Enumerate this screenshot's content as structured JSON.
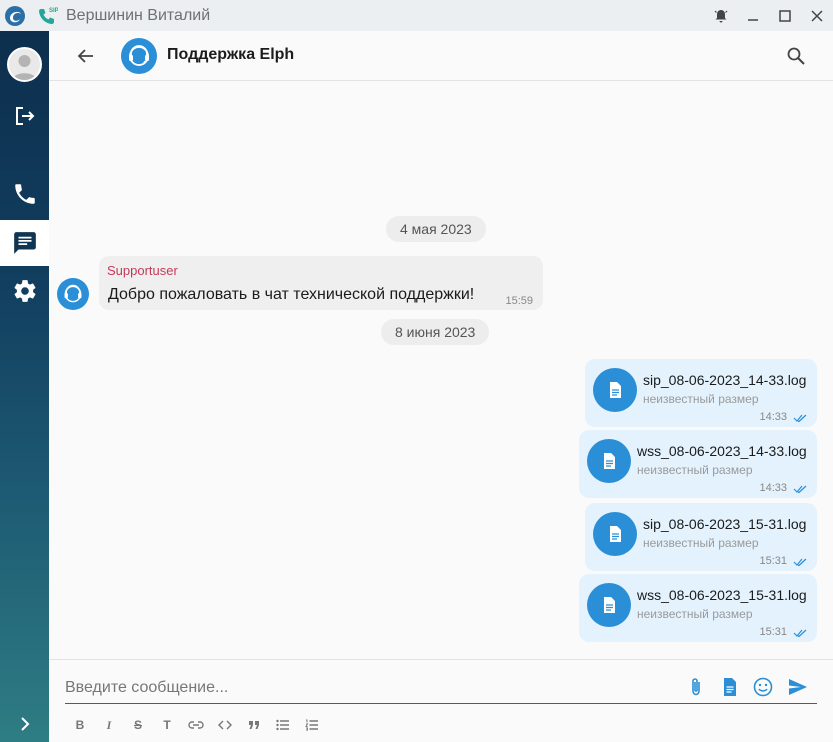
{
  "window": {
    "title": "Вершинин Виталий",
    "icons": [
      "app-logo-icon",
      "sip-phone-icon",
      "bell-icon",
      "minimize-icon",
      "maximize-icon",
      "close-icon"
    ]
  },
  "sidebar": {
    "items": [
      {
        "name": "avatar"
      },
      {
        "name": "logout-icon"
      },
      {
        "name": "phone-icon"
      },
      {
        "name": "chat-icon",
        "active": true
      },
      {
        "name": "gear-icon"
      },
      {
        "name": "chevron-right-icon"
      }
    ]
  },
  "header": {
    "title": "Поддержка Elph"
  },
  "messages": {
    "date1": "4 мая 2023",
    "incoming": {
      "sender": "Supportuser",
      "text": "Добро пожаловать в чат технической поддержки!",
      "time": "15:59"
    },
    "date2": "8 июня 2023",
    "files": [
      {
        "name": "sip_08-06-2023_14-33.log",
        "size": "неизвестный размер",
        "time": "14:33"
      },
      {
        "name": "wss_08-06-2023_14-33.log",
        "size": "неизвестный размер",
        "time": "14:33"
      },
      {
        "name": "sip_08-06-2023_15-31.log",
        "size": "неизвестный размер",
        "time": "15:31"
      },
      {
        "name": "wss_08-06-2023_15-31.log",
        "size": "неизвестный размер",
        "time": "15:31"
      }
    ]
  },
  "composer": {
    "placeholder": "Введите сообщение...",
    "format_buttons": [
      "B",
      "I",
      "S",
      "T",
      "link",
      "code",
      "quote",
      "bulleted-list",
      "numbered-list"
    ]
  },
  "colors": {
    "accent": "#2a8fd6",
    "sender": "#c53a59",
    "outgoing_bubble": "#e3f2fd",
    "incoming_bubble": "#efefef"
  }
}
